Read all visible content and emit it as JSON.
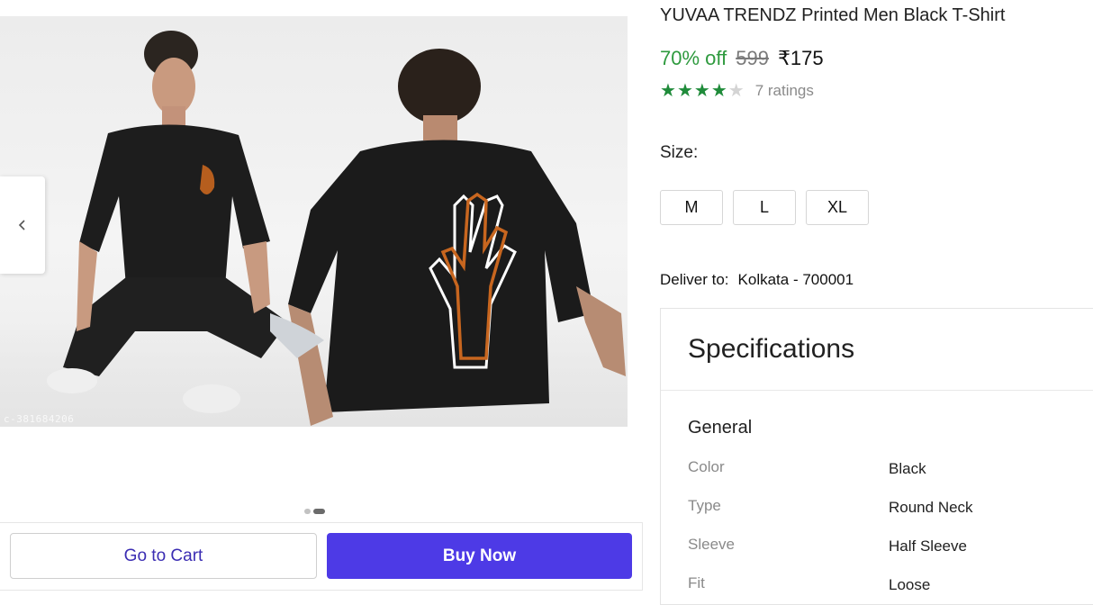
{
  "gallery": {
    "watermark": "c-381684206",
    "dots": [
      {
        "active": false
      },
      {
        "active": true
      }
    ]
  },
  "actions": {
    "go_to_cart": "Go to Cart",
    "buy_now": "Buy Now"
  },
  "product": {
    "title": "YUVAA TRENDZ Printed Men Black T-Shirt",
    "discount": "70% off",
    "mrp": "599",
    "price": "₹175",
    "rating_value": 4,
    "rating_max": 5,
    "ratings_count": "7 ratings"
  },
  "size": {
    "label": "Size:",
    "options": [
      "M",
      "L",
      "XL"
    ]
  },
  "delivery": {
    "label": "Deliver to:",
    "location": "Kolkata - 700001"
  },
  "specifications": {
    "title": "Specifications",
    "group": "General",
    "rows": [
      {
        "key": "Color",
        "value": "Black"
      },
      {
        "key": "Type",
        "value": "Round Neck"
      },
      {
        "key": "Sleeve",
        "value": "Half Sleeve"
      },
      {
        "key": "Fit",
        "value": "Loose"
      }
    ]
  },
  "colors": {
    "discount_green": "#2e9a3e",
    "star_green": "#1f8b3a",
    "buy_button": "#4d3ae6",
    "cart_text": "#3b2db3",
    "tshirt_print_orange": "#c8661f"
  }
}
